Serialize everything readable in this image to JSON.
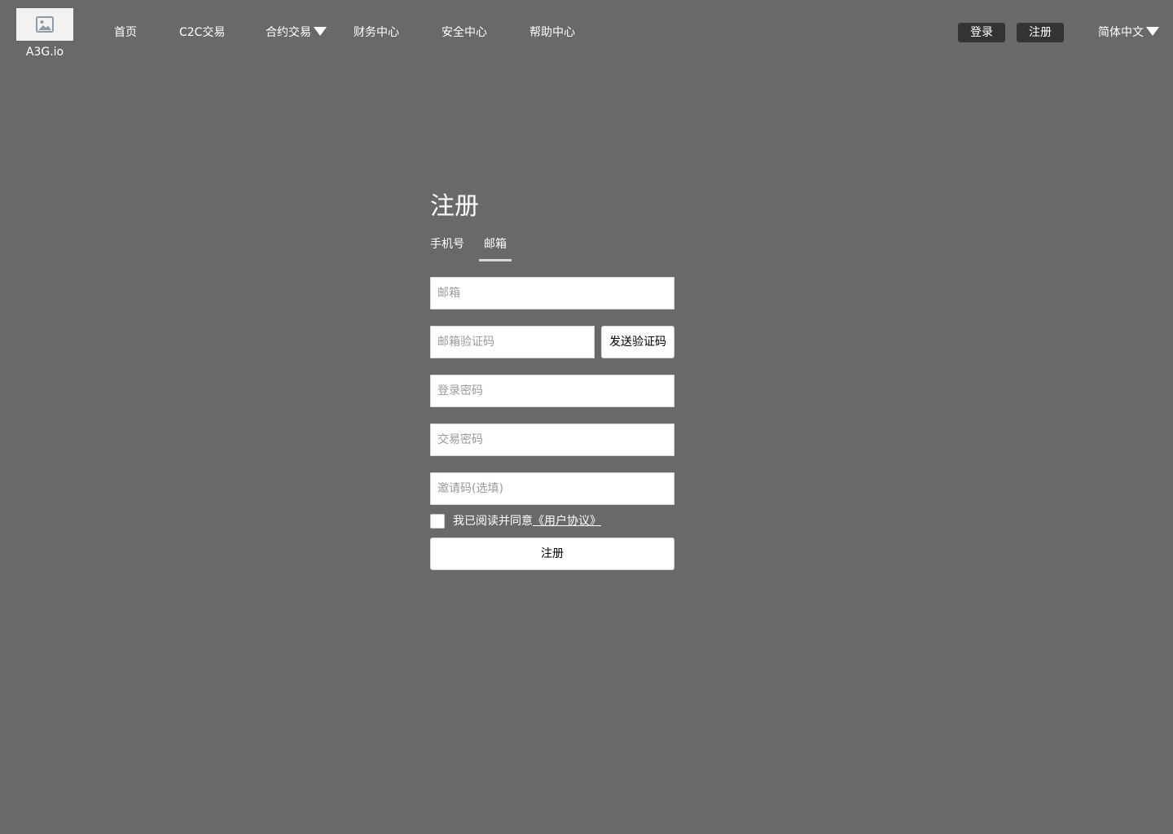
{
  "header": {
    "logo_icon": "image-placeholder-icon",
    "logo_text": "A3G.io",
    "nav": {
      "home": "首页",
      "c2c": "C2C交易",
      "contract": "合约交易",
      "finance": "财务中心",
      "security": "安全中心",
      "help": "帮助中心"
    },
    "login_label": "登录",
    "register_label": "注册",
    "language": "简体中文"
  },
  "register_form": {
    "title": "注册",
    "tabs": {
      "phone": "手机号",
      "email": "邮箱"
    },
    "active_tab": "email",
    "fields": {
      "email": {
        "placeholder": "邮箱",
        "value": ""
      },
      "email_code": {
        "placeholder": "邮箱验证码",
        "value": ""
      },
      "login_password": {
        "placeholder": "登录密码",
        "value": ""
      },
      "trade_password": {
        "placeholder": "交易密码",
        "value": ""
      },
      "invite_code": {
        "placeholder": "邀请码(选填)",
        "value": ""
      }
    },
    "send_code_label": "发送验证码",
    "agreement_prefix": "我已阅读并同意",
    "agreement_link": "《用户协议》",
    "agreement_checked": false,
    "submit_label": "注册"
  },
  "colors": {
    "background": "#696969",
    "header_button_bg": "#333333",
    "text": "#ffffff"
  }
}
